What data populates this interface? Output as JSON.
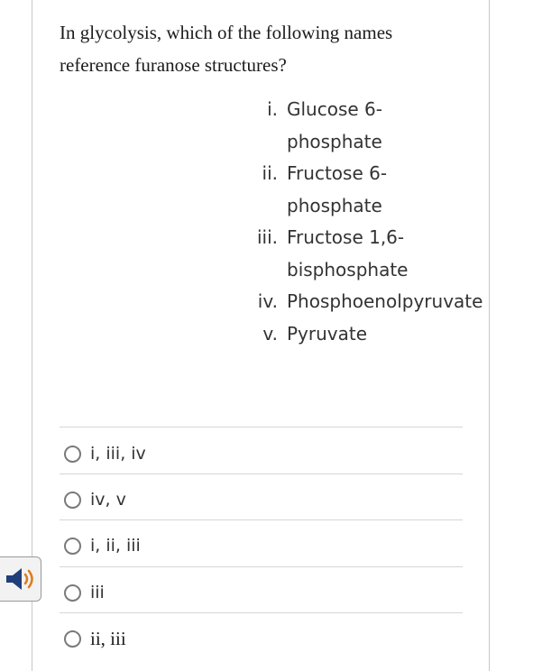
{
  "question": {
    "text_line1": "In glycolysis, which of the following names",
    "text_line2": "reference furanose structures?"
  },
  "roman_list": [
    {
      "num": "i.",
      "line1": "Glucose 6-",
      "line2": "phosphate"
    },
    {
      "num": "ii.",
      "line1": "Fructose 6-",
      "line2": "phosphate"
    },
    {
      "num": "iii.",
      "line1": "Fructose 1,6-",
      "line2": "bisphosphate"
    },
    {
      "num": "iv.",
      "line1": "Phosphoenolpyruvate"
    },
    {
      "num": "v.",
      "line1": "Pyruvate"
    }
  ],
  "options": [
    {
      "label": "i, iii, iv"
    },
    {
      "label": "iv, v"
    },
    {
      "label": "i, ii, iii"
    },
    {
      "label": "iii"
    },
    {
      "label": "ii, iii"
    }
  ],
  "audio": {
    "icon": "speaker-icon",
    "colors": {
      "speaker": "#1f3f7a",
      "waves": "#e07b1a"
    }
  }
}
